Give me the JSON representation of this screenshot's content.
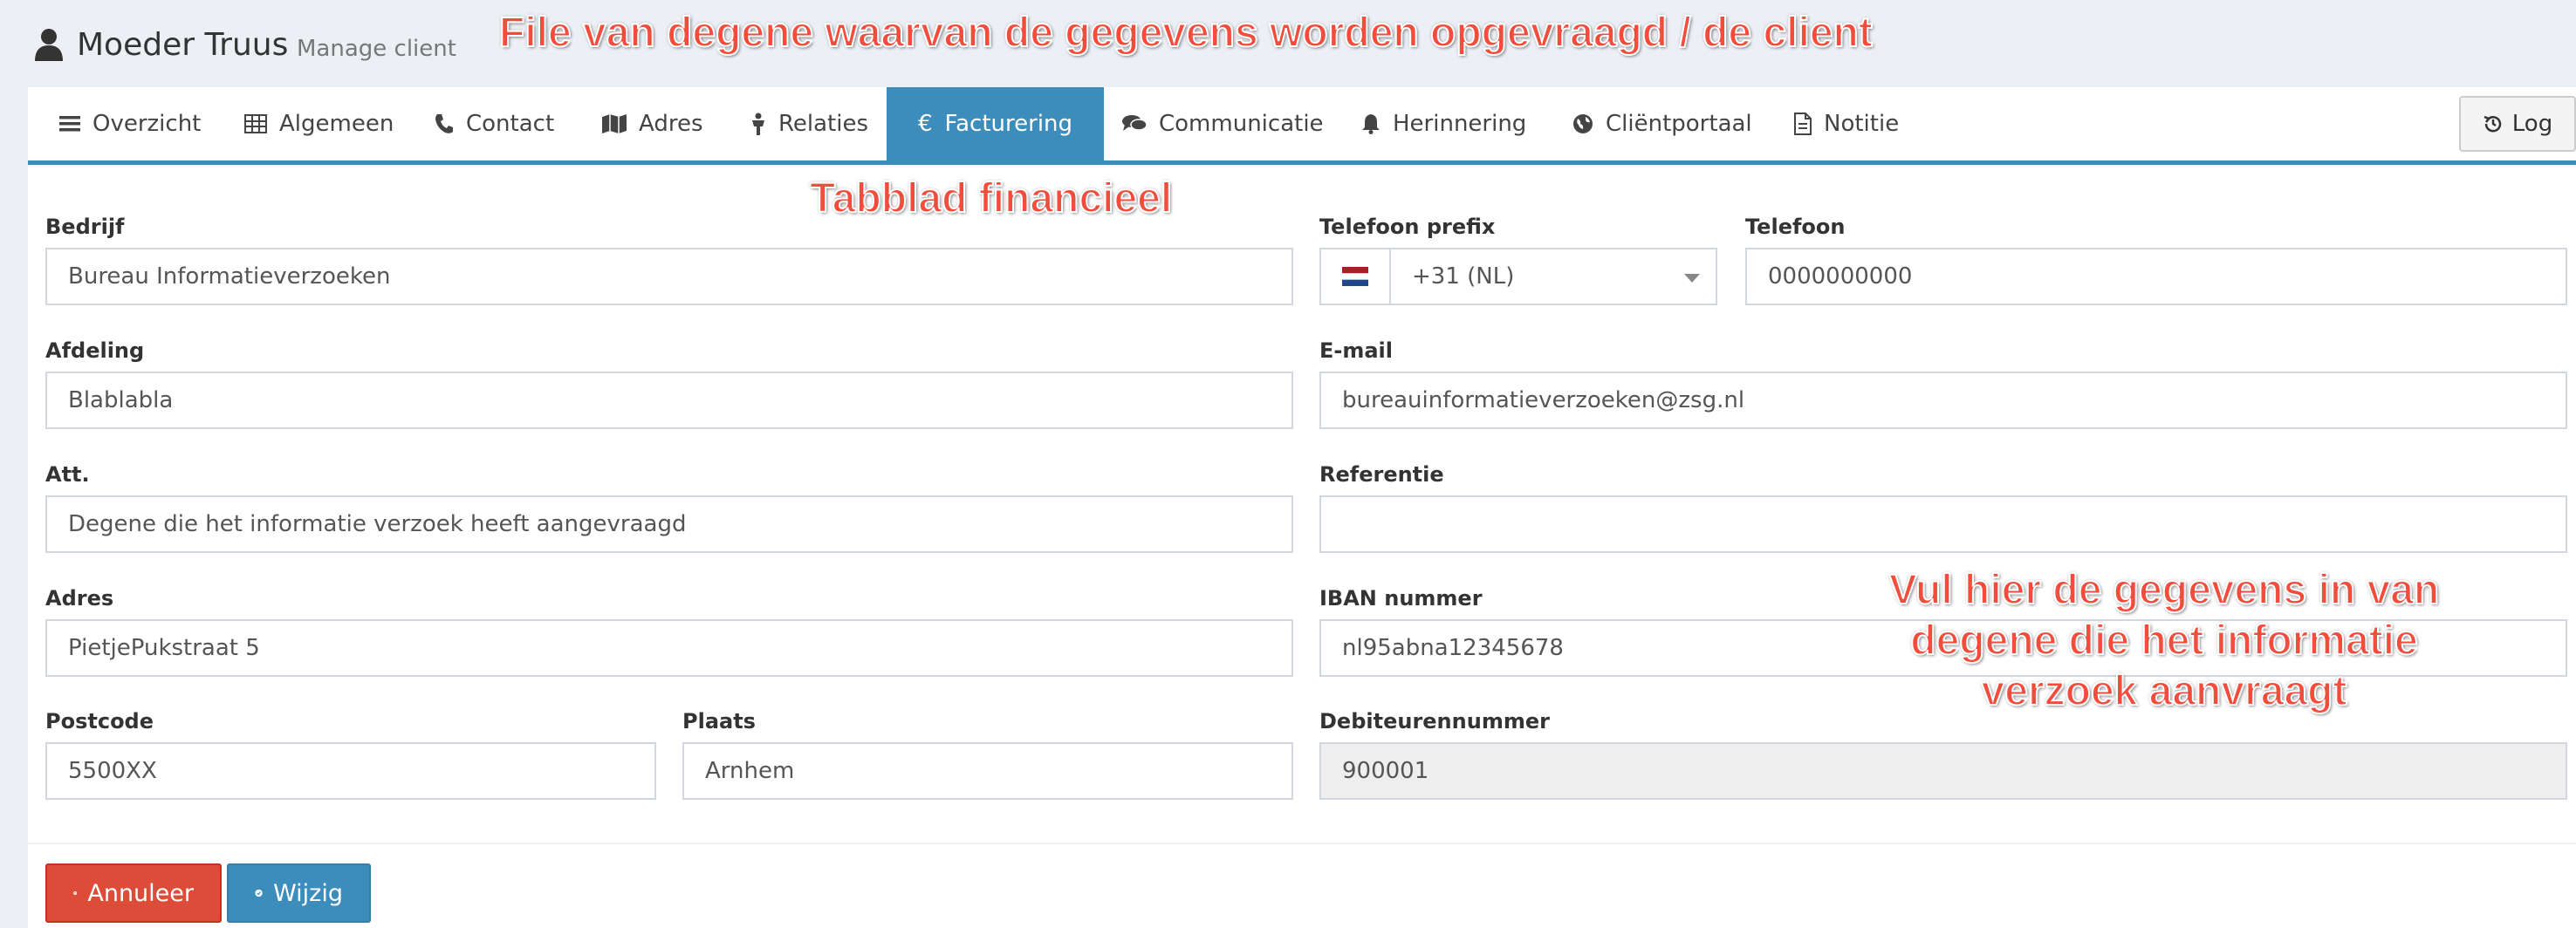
{
  "header": {
    "title": "Moeder Truus",
    "subtitle": "Manage client"
  },
  "tabs": [
    {
      "label": "Overzicht",
      "icon": "list-icon"
    },
    {
      "label": "Algemeen",
      "icon": "table-icon"
    },
    {
      "label": "Contact",
      "icon": "phone-icon"
    },
    {
      "label": "Adres",
      "icon": "map-icon"
    },
    {
      "label": "Relaties",
      "icon": "people-icon"
    },
    {
      "label": "Facturering",
      "icon": "euro-icon",
      "active": true
    },
    {
      "label": "Communicatie",
      "icon": "comments-icon"
    },
    {
      "label": "Herinnering",
      "icon": "bell-icon"
    },
    {
      "label": "Cliëntportaal",
      "icon": "globe-icon"
    },
    {
      "label": "Notitie",
      "icon": "file-icon"
    }
  ],
  "log_button": "Log",
  "form": {
    "bedrijf": {
      "label": "Bedrijf",
      "value": "Bureau Informatieverzoeken"
    },
    "afdeling": {
      "label": "Afdeling",
      "value": "Blablabla"
    },
    "att": {
      "label": "Att.",
      "value": "Degene die het informatie verzoek heeft aangevraagd"
    },
    "adres": {
      "label": "Adres",
      "value": "PietjePukstraat 5"
    },
    "postcode": {
      "label": "Postcode",
      "value": "5500XX"
    },
    "plaats": {
      "label": "Plaats",
      "value": "Arnhem"
    },
    "telefoon_prefix": {
      "label": "Telefoon prefix",
      "value": "+31 (NL)"
    },
    "telefoon": {
      "label": "Telefoon",
      "value": "0000000000"
    },
    "email": {
      "label": "E-mail",
      "value": "bureauinformatieverzoeken@zsg.nl"
    },
    "referentie": {
      "label": "Referentie",
      "value": ""
    },
    "iban": {
      "label": "IBAN nummer",
      "value": "nl95abna12345678"
    },
    "debiteurennummer": {
      "label": "Debiteurennummer",
      "value": "900001"
    }
  },
  "buttons": {
    "cancel": "Annuleer",
    "save": "Wijzig"
  },
  "annotations": {
    "top": "File van degene waarvan de gegevens worden opgevraagd / de client",
    "tab": "Tabblad financieel",
    "right_line1": "Vul hier de gegevens in van",
    "right_line2": "degene die het informatie",
    "right_line3": "verzoek aanvraagt"
  },
  "colors": {
    "accent": "#3c8dbc",
    "danger": "#dd4b39",
    "highlight": "#ffe100",
    "annotation": "#f24c3d"
  }
}
